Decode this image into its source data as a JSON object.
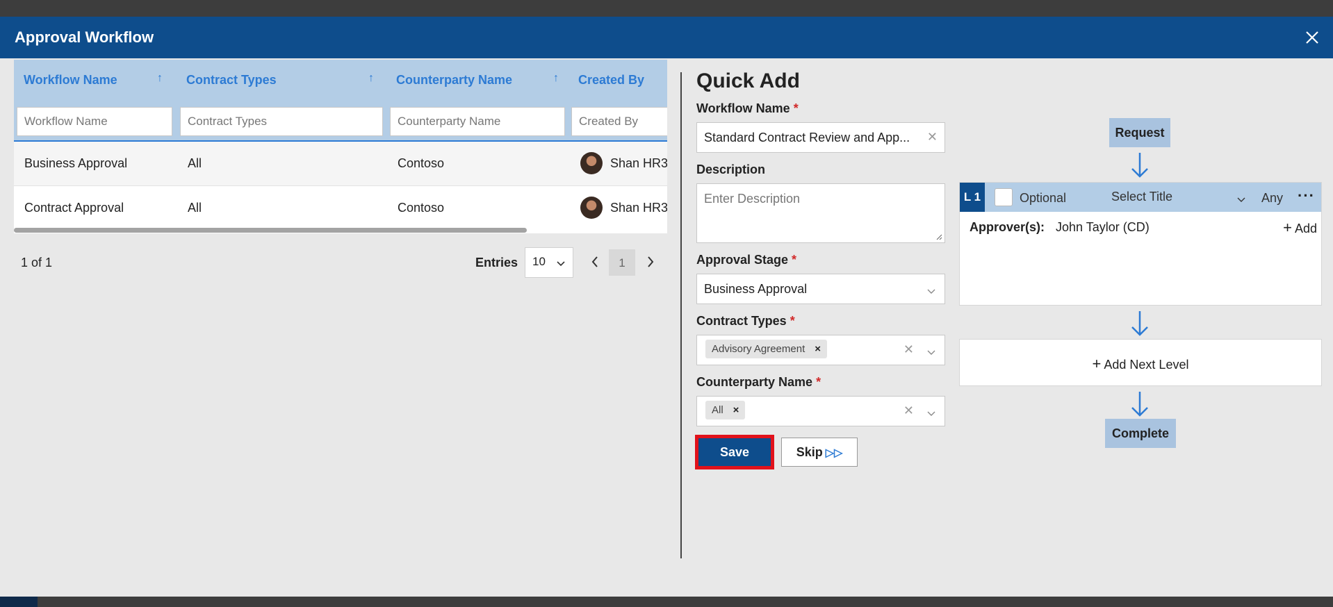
{
  "modal": {
    "title": "Approval Workflow"
  },
  "table": {
    "columns": [
      {
        "label": "Workflow Name",
        "filter_placeholder": "Workflow Name"
      },
      {
        "label": "Contract Types",
        "filter_placeholder": "Contract Types"
      },
      {
        "label": "Counterparty Name",
        "filter_placeholder": "Counterparty Name"
      },
      {
        "label": "Created By",
        "filter_placeholder": "Created By"
      }
    ],
    "sort_icon": "↑",
    "rows": [
      {
        "workflow_name": "Business Approval",
        "contract_types": "All",
        "counterparty": "Contoso",
        "created_by": "Shan HR3"
      },
      {
        "workflow_name": "Contract Approval",
        "contract_types": "All",
        "counterparty": "Contoso",
        "created_by": "Shan HR3"
      }
    ]
  },
  "pager": {
    "count": "1 of 1",
    "entries_label": "Entries",
    "entries_value": "10",
    "page": "1"
  },
  "form": {
    "title": "Quick Add",
    "workflow_name": {
      "label": "Workflow Name",
      "required": "*",
      "value": "Standard Contract Review and App..."
    },
    "description": {
      "label": "Description",
      "placeholder": "Enter Description"
    },
    "approval_stage": {
      "label": "Approval Stage",
      "required": "*",
      "value": "Business Approval"
    },
    "contract_types": {
      "label": "Contract Types",
      "required": "*",
      "tag": "Advisory Agreement"
    },
    "counterparty": {
      "label": "Counterparty Name",
      "required": "*",
      "tag": "All"
    },
    "save_label": "Save",
    "skip_label": "Skip"
  },
  "flow": {
    "request_label": "Request",
    "level": {
      "badge": "L 1",
      "optional_label": "Optional",
      "select_title": "Select Title",
      "mode": "Any",
      "more": "···",
      "approvers_label": "Approver(s):",
      "approver": "John Taylor (CD)",
      "add_label": "Add"
    },
    "add_next_level": "Add Next Level",
    "complete_label": "Complete"
  },
  "colors": {
    "header": "#0e4d8c",
    "accent": "#2d7bd4",
    "table_head": "#b3cde6",
    "save_highlight": "#e1121b"
  }
}
